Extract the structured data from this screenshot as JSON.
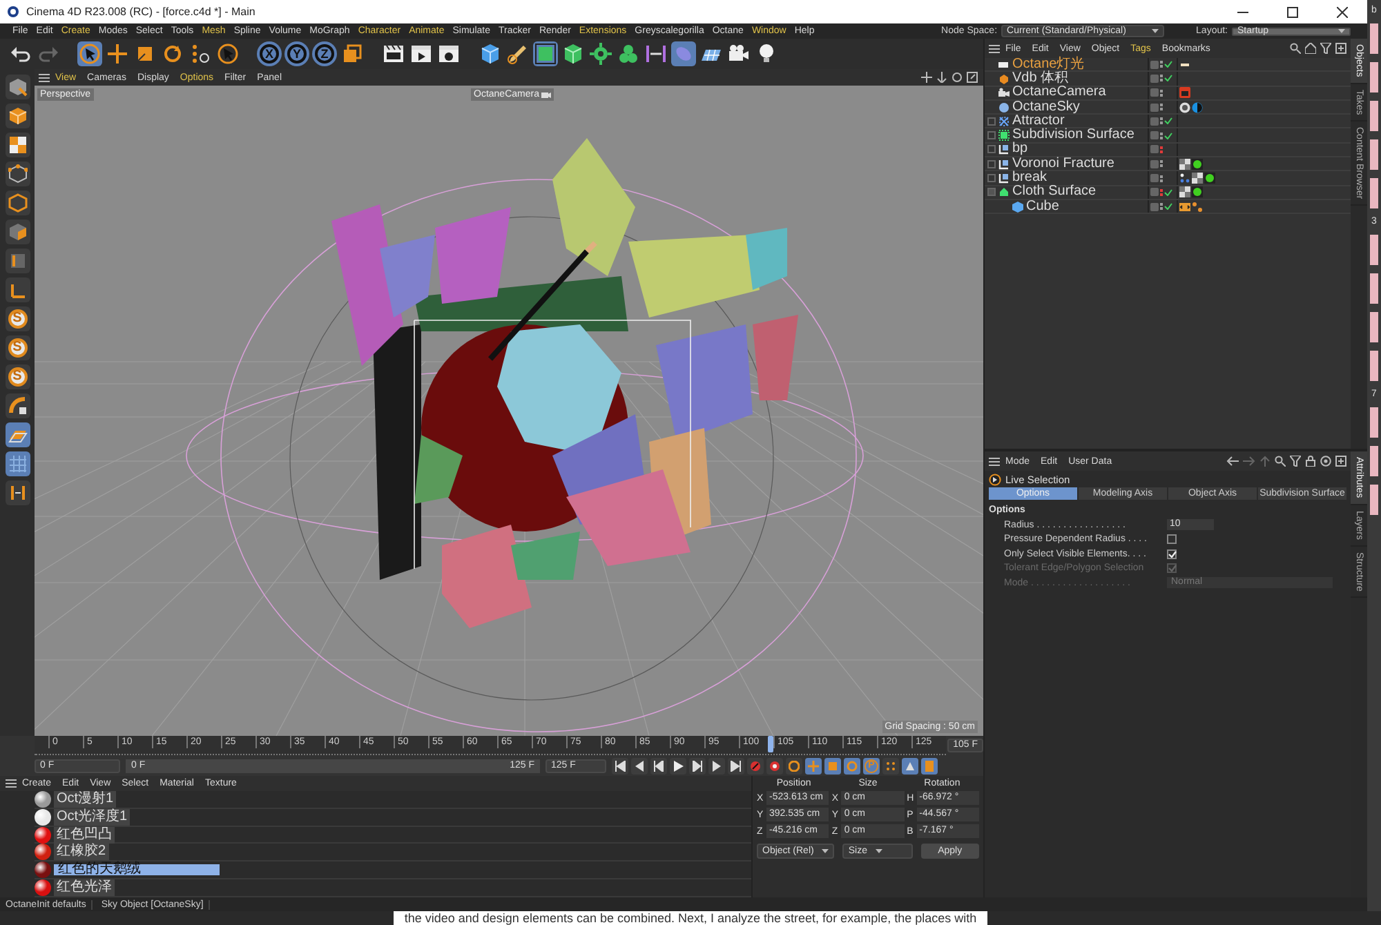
{
  "window": {
    "title": "Cinema 4D R23.008 (RC) - [force.c4d *] - Main"
  },
  "menu": [
    {
      "label": "File",
      "highlighted": false
    },
    {
      "label": "Edit",
      "highlighted": false
    },
    {
      "label": "Create",
      "highlighted": true
    },
    {
      "label": "Modes",
      "highlighted": false
    },
    {
      "label": "Select",
      "highlighted": false
    },
    {
      "label": "Tools",
      "highlighted": false
    },
    {
      "label": "Mesh",
      "highlighted": true
    },
    {
      "label": "Spline",
      "highlighted": false
    },
    {
      "label": "Volume",
      "highlighted": false
    },
    {
      "label": "MoGraph",
      "highlighted": false
    },
    {
      "label": "Character",
      "highlighted": true
    },
    {
      "label": "Animate",
      "highlighted": true
    },
    {
      "label": "Simulate",
      "highlighted": false
    },
    {
      "label": "Tracker",
      "highlighted": false
    },
    {
      "label": "Render",
      "highlighted": false
    },
    {
      "label": "Extensions",
      "highlighted": true
    },
    {
      "label": "Greyscalegorilla",
      "highlighted": false
    },
    {
      "label": "Octane",
      "highlighted": false
    },
    {
      "label": "Window",
      "highlighted": true
    },
    {
      "label": "Help",
      "highlighted": false
    }
  ],
  "node_space": {
    "label": "Node Space:",
    "value": "Current (Standard/Physical)"
  },
  "layout": {
    "label": "Layout:",
    "value": "Startup"
  },
  "axes": [
    "X",
    "Y",
    "Z"
  ],
  "left_tool_letters": [
    "S",
    "S",
    "S"
  ],
  "viewport": {
    "menu": [
      {
        "label": "View",
        "highlighted": true
      },
      {
        "label": "Cameras",
        "highlighted": false
      },
      {
        "label": "Display",
        "highlighted": false
      },
      {
        "label": "Options",
        "highlighted": true
      },
      {
        "label": "Filter",
        "highlighted": false
      },
      {
        "label": "Panel",
        "highlighted": false
      }
    ],
    "view_label": "Perspective",
    "camera_label": "OctaneCamera",
    "grid_spacing": "Grid Spacing : 50 cm"
  },
  "timeline": {
    "ticks": [
      "0",
      "5",
      "10",
      "15",
      "20",
      "25",
      "30",
      "35",
      "40",
      "45",
      "50",
      "55",
      "60",
      "65",
      "70",
      "75",
      "80",
      "85",
      "90",
      "95",
      "100",
      "105",
      "110",
      "115",
      "120",
      "125"
    ],
    "playhead": {
      "level": 0.84
    },
    "current_frame": "105 F",
    "start_frame": "0 F",
    "range_start": "0 F",
    "range_end": "125 F",
    "end_frame": "125 F",
    "key_letter": "P"
  },
  "object_manager": {
    "menu": [
      {
        "label": "File",
        "highlighted": false
      },
      {
        "label": "Edit",
        "highlighted": false
      },
      {
        "label": "View",
        "highlighted": false
      },
      {
        "label": "Object",
        "highlighted": false
      },
      {
        "label": "Tags",
        "highlighted": true
      },
      {
        "label": "Bookmarks",
        "highlighted": false
      }
    ],
    "objects": [
      {
        "name": "Octane灯光",
        "kind": "light",
        "highlighted": true,
        "visible": true,
        "enabled": true,
        "tags": [
          {
            "kind": "light"
          }
        ]
      },
      {
        "name": "Vdb 体积",
        "kind": "volume",
        "highlighted": false,
        "visible": true,
        "enabled": true
      },
      {
        "name": "OctaneCamera",
        "kind": "camera",
        "highlighted": false,
        "visible": true,
        "enabled": false,
        "tags": [
          {
            "kind": "camera"
          }
        ]
      },
      {
        "name": "OctaneSky",
        "kind": "sky",
        "highlighted": false,
        "visible": true,
        "enabled": false,
        "tags": [
          {
            "kind": "sphere"
          },
          {
            "kind": "environment"
          }
        ]
      },
      {
        "name": "Attractor",
        "kind": "attractor",
        "highlighted": false,
        "visible": true,
        "enabled": true,
        "expanded": false
      },
      {
        "name": "Subdivision Surface",
        "kind": "subdivision",
        "highlighted": false,
        "visible": true,
        "enabled": true,
        "expanded": false
      },
      {
        "name": "bp",
        "kind": "generator",
        "highlighted": false,
        "visible": false,
        "enabled": false,
        "expanded": false
      },
      {
        "name": "Voronoi Fracture",
        "kind": "generator",
        "highlighted": false,
        "visible": true,
        "enabled": false,
        "expanded": false,
        "tags": [
          {
            "kind": "material"
          },
          {
            "kind": "ball"
          }
        ]
      },
      {
        "name": "break",
        "kind": "generator",
        "highlighted": false,
        "visible": true,
        "enabled": false,
        "expanded": false,
        "tags": [
          {
            "kind": "points"
          },
          {
            "kind": "material"
          },
          {
            "kind": "ball"
          }
        ]
      },
      {
        "name": "Cloth Surface",
        "kind": "cloth",
        "highlighted": false,
        "visible": false,
        "enabled": true,
        "expanded": true,
        "tags": [
          {
            "kind": "material"
          },
          {
            "kind": "ball"
          }
        ],
        "children": [
          {
            "name": "Cube",
            "kind": "cube",
            "highlighted": false,
            "visible": true,
            "enabled": true,
            "tags": [
              {
                "kind": "code"
              },
              {
                "kind": "dots"
              }
            ]
          }
        ]
      }
    ]
  },
  "object_side_tabs": [
    {
      "label": "Objects",
      "selected": true
    },
    {
      "label": "Takes",
      "selected": false
    },
    {
      "label": "Content Browser",
      "selected": false
    }
  ],
  "attributes": {
    "menu": [
      "Mode",
      "Edit",
      "User Data"
    ],
    "title": "Live Selection",
    "tabs": [
      {
        "label": "Options",
        "selected": true
      },
      {
        "label": "Modeling Axis",
        "selected": false
      },
      {
        "label": "Object Axis",
        "selected": false
      },
      {
        "label": "Subdivision Surface",
        "selected": false
      }
    ],
    "section": "Options",
    "fields": [
      {
        "kind": "number",
        "label": "Radius . . . . . . . . . . . . . . . . .",
        "value": "10",
        "disabled": false
      },
      {
        "kind": "checkbox",
        "label": "Pressure Dependent Radius . . . .",
        "checked": false,
        "disabled": false
      },
      {
        "kind": "checkbox",
        "label": "Only Select Visible Elements. . . .",
        "checked": true,
        "disabled": false
      },
      {
        "kind": "checkbox",
        "label": "Tolerant Edge/Polygon Selection",
        "checked": true,
        "disabled": true
      },
      {
        "kind": "dropdown",
        "label": "Mode . . . . . . . . . . . . . . . . . . .",
        "value": "Normal",
        "disabled": true
      }
    ]
  },
  "attribute_side_tabs": [
    {
      "label": "Attributes",
      "selected": true
    },
    {
      "label": "Layers",
      "selected": false
    },
    {
      "label": "Structure",
      "selected": false
    }
  ],
  "material_manager": {
    "menu": [
      "Create",
      "Edit",
      "View",
      "Select",
      "Material",
      "Texture"
    ],
    "materials": [
      {
        "name": "Oct漫射1",
        "color": "#9a9a9a",
        "selected": false
      },
      {
        "name": "Oct光泽度1",
        "color": "#e8e8e8",
        "selected": false
      },
      {
        "name": "红色凹凸",
        "color": "#e01010",
        "selected": false
      },
      {
        "name": "红橡胶2",
        "color": "#d02010",
        "selected": false
      },
      {
        "name": "红色的天鹅绒",
        "color": "#7a1010",
        "selected": true
      },
      {
        "name": "红色光泽",
        "color": "#d81010",
        "selected": false
      }
    ]
  },
  "coordinates": {
    "headers": [
      "Position",
      "Size",
      "Rotation"
    ],
    "rows": [
      [
        {
          "axis": "X",
          "value": "-523.613 cm"
        },
        {
          "axis": "X",
          "value": "0 cm"
        },
        {
          "axis": "H",
          "value": "-66.972 °"
        }
      ],
      [
        {
          "axis": "Y",
          "value": "392.535 cm"
        },
        {
          "axis": "Y",
          "value": "0 cm"
        },
        {
          "axis": "P",
          "value": "-44.567 °"
        }
      ],
      [
        {
          "axis": "Z",
          "value": "-45.216 cm"
        },
        {
          "axis": "Z",
          "value": "0 cm"
        },
        {
          "axis": "B",
          "value": "-7.167 °"
        }
      ]
    ],
    "mode": "Object (Rel)",
    "size_mode": "Size",
    "apply": "Apply"
  },
  "status_bar": [
    "OctaneInit defaults",
    "Sky Object [OctaneSky]"
  ],
  "edge_window": {
    "texts": [
      "b",
      "3",
      "7"
    ]
  },
  "background_text": "the video and design elements can be combined. Next, I analyze the street, for example, the places with"
}
